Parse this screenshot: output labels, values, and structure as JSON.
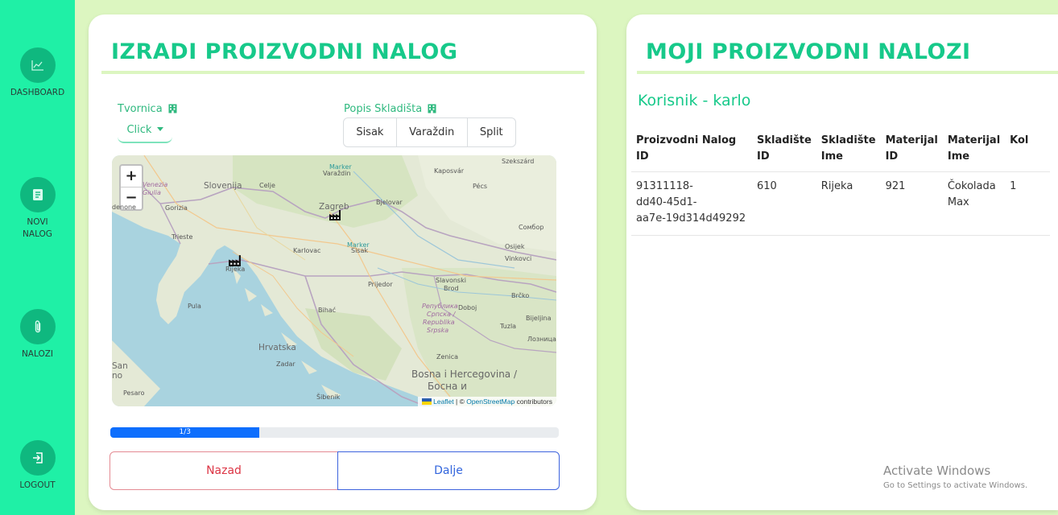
{
  "sidebar": {
    "items": [
      {
        "label": "DASHBOARD",
        "icon": "chart-line-icon"
      },
      {
        "label": "NOVI\nNALOG",
        "label_line1": "NOVI",
        "label_line2": "NALOG",
        "icon": "document-icon"
      },
      {
        "label": "NALOZI",
        "icon": "paperclip-icon"
      },
      {
        "label": "LOGOUT",
        "icon": "logout-icon"
      }
    ],
    "bg_color": "#1ff0a6"
  },
  "create_order": {
    "title": "IZRADI PROIZVODNI NALOG",
    "factory_label": "Tvornica",
    "factory_button": "Click",
    "warehouses_label": "Popis Skladišta",
    "warehouses": [
      "Sisak",
      "Varaždin",
      "Split"
    ],
    "map": {
      "zoom_in": "+",
      "zoom_out": "−",
      "labels": {
        "venezia": "Venezia",
        "giulia": "Giulia",
        "denone": "denone",
        "gorizia": "Gorizia",
        "slovenija": "Slovenija",
        "celje": "Celje",
        "trieste": "Trieste",
        "karlovac": "Karlovac",
        "rijeka": "Rijeka",
        "pula": "Pula",
        "zagreb": "Zagreb",
        "varazdin": "Varaždin",
        "kaposvar": "Kaposvár",
        "szekszard": "Szekszárd",
        "pecs": "Pécs",
        "bjelovar": "Bjelovar",
        "sombor": "Сомбор",
        "osijek": "Osijek",
        "vinkovci": "Vinkovci",
        "sisak": "Sisak",
        "prijedor": "Prijedor",
        "slavonski": "Slavonski",
        "brod": "Brod",
        "brcko": "Brčko",
        "bihac": "Bihać",
        "doboj": "Doboj",
        "republika1": "Република",
        "republika2": "Српска /",
        "republika3": "Republika",
        "republika4": "Srpska",
        "bijeljina": "Bijeljina",
        "tuzla": "Tuzla",
        "loznica": "Лозница",
        "hrvatska": "Hrvatska",
        "zadar": "Zadar",
        "zenica": "Zenica",
        "bih1": "Bosna i Hercegovina /",
        "bih2": "Босна и",
        "san": "San",
        "no": "no",
        "pesaro": "Pesaro",
        "sibenik": "Šibenik",
        "marker1": "Marker",
        "marker2": "Marker"
      },
      "attribution_leaflet": "Leaflet",
      "attribution_sep": " | © ",
      "attribution_osm": "OpenStreetMap",
      "attribution_rest": " contributors"
    },
    "progress": {
      "text": "1/3",
      "value": 0.333,
      "color": "#0d6efd"
    },
    "back_button": "Nazad",
    "next_button": "Dalje"
  },
  "my_orders": {
    "title": "MOJI PROIZVODNI NALOZI",
    "user_line": "Korisnik - karlo",
    "columns": [
      "Proizvodni Nalog ID",
      "Skladište ID",
      "Skladište Ime",
      "Materijal ID",
      "Materijal Ime",
      "Kol"
    ],
    "rows": [
      {
        "id": "91311118-dd40-45d1-aa7e-19d314d49292",
        "id_l1": "91311118-",
        "id_l2": "dd40-45d1-",
        "id_l3": "aa7e-19d314d49292",
        "warehouse_id": "610",
        "warehouse_name": "Rijeka",
        "material_id": "921",
        "material_name": "Čokolada Max",
        "qty": "1"
      }
    ]
  },
  "watermark": {
    "line1": "Activate Windows",
    "line2": "Go to Settings to activate Windows."
  },
  "colors": {
    "accent": "#17c98a",
    "page_bg": "#dcf6c0",
    "danger": "#dc3545",
    "primary": "#0d6efd"
  }
}
